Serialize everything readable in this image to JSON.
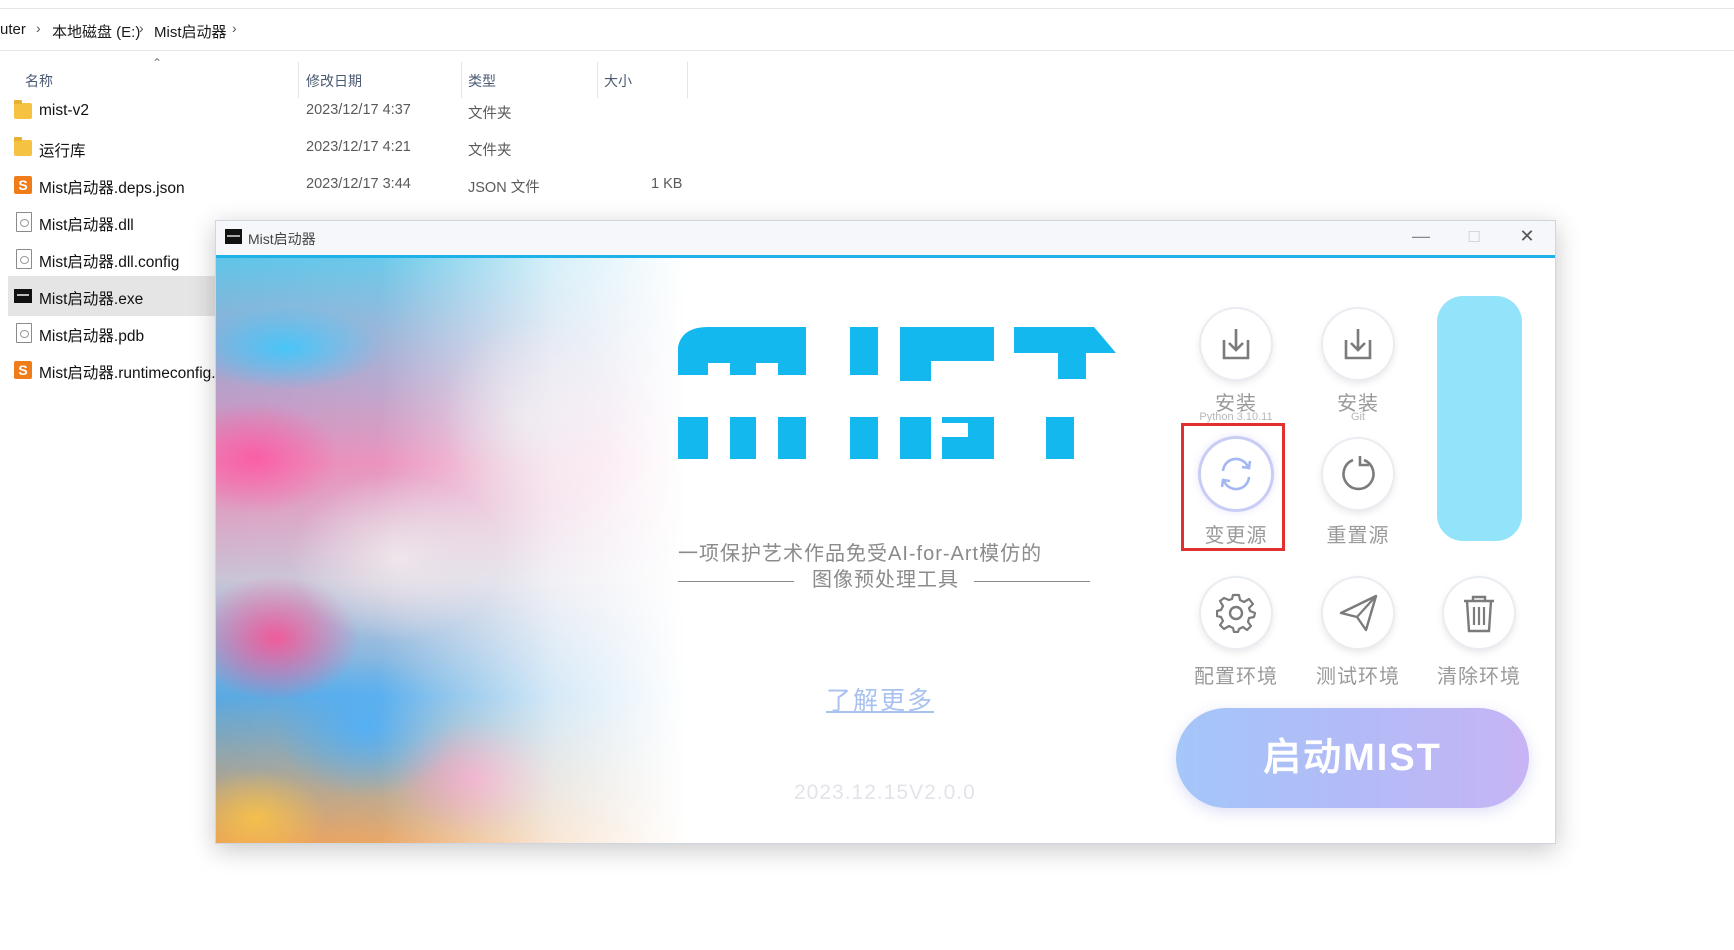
{
  "explorer": {
    "breadcrumb": [
      "uter",
      "本地磁盘 (E:)",
      "Mist启动器"
    ],
    "columns": {
      "name": "名称",
      "date": "修改日期",
      "type": "类型",
      "size": "大小"
    },
    "files": [
      {
        "name": "mist-v2",
        "date": "2023/12/17 4:37",
        "type": "文件夹",
        "size": "",
        "icon": "folder-icon"
      },
      {
        "name": "运行库",
        "date": "2023/12/17 4:21",
        "type": "文件夹",
        "size": "",
        "icon": "folder-icon"
      },
      {
        "name": "Mist启动器.deps.json",
        "date": "2023/12/17 3:44",
        "type": "JSON 文件",
        "size": "1 KB",
        "icon": "sublime-file-icon"
      },
      {
        "name": "Mist启动器.dll",
        "date": "",
        "type": "",
        "size": "",
        "icon": "dll-file-icon"
      },
      {
        "name": "Mist启动器.dll.config",
        "date": "",
        "type": "",
        "size": "",
        "icon": "config-file-icon"
      },
      {
        "name": "Mist启动器.exe",
        "date": "",
        "type": "",
        "size": "",
        "icon": "exe-file-icon",
        "selected": true
      },
      {
        "name": "Mist启动器.pdb",
        "date": "",
        "type": "",
        "size": "",
        "icon": "pdb-file-icon"
      },
      {
        "name": "Mist启动器.runtimeconfig.js",
        "date": "",
        "type": "",
        "size": "",
        "icon": "sublime-file-icon"
      }
    ]
  },
  "launcher": {
    "window_title": "Mist启动器",
    "controls": {
      "minimize": "—",
      "maximize": "☐",
      "close": "✕"
    },
    "logo_text": "MIST",
    "subtitle_line1": "一项保护艺术作品免受AI-for-Art模仿的",
    "subtitle_line2": "图像预处理工具",
    "learn_more": "了解更多",
    "version": "2023.12.15V2.0.0",
    "buttons": {
      "install_python": {
        "label": "安装",
        "sub": "Python 3.10.11"
      },
      "install_git": {
        "label": "安装",
        "sub": "Git"
      },
      "change_source": {
        "label": "变更源"
      },
      "reset_source": {
        "label": "重置源"
      },
      "config_env": {
        "label": "配置环境"
      },
      "test_env": {
        "label": "测试环境"
      },
      "clear_env": {
        "label": "清除环境"
      }
    },
    "launch_button": "启动MIST",
    "colors": {
      "accent": "#1fb2e8",
      "logo": "#12b8ee",
      "highlight_box": "#e03030",
      "side_pill": "#93e3fb"
    }
  }
}
